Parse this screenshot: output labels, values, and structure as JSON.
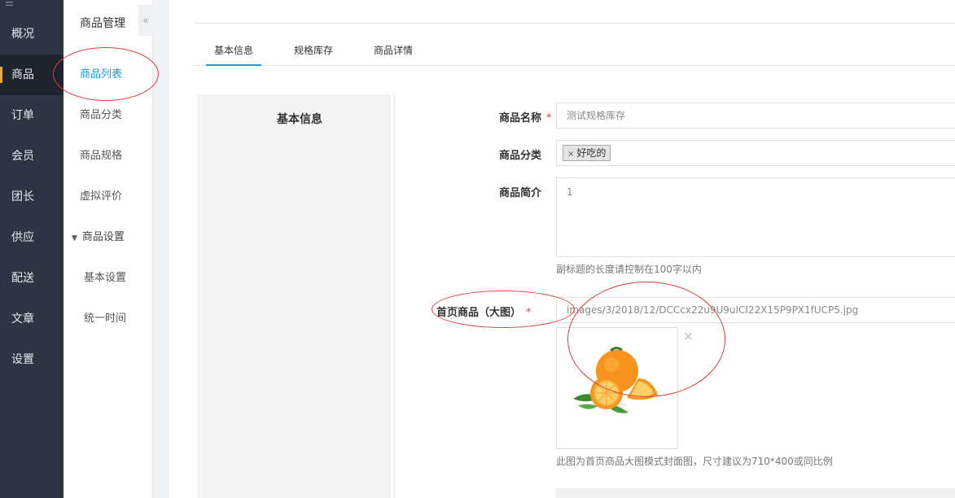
{
  "nav": {
    "items": [
      {
        "label": "概况"
      },
      {
        "label": "商品"
      },
      {
        "label": "订单"
      },
      {
        "label": "会员"
      },
      {
        "label": "团长"
      },
      {
        "label": "供应"
      },
      {
        "label": "配送"
      },
      {
        "label": "文章"
      },
      {
        "label": "设置"
      }
    ]
  },
  "subnav": {
    "title": "商品管理",
    "items": [
      {
        "label": "商品列表"
      },
      {
        "label": "商品分类"
      },
      {
        "label": "商品规格"
      },
      {
        "label": "虚拟评价"
      }
    ],
    "group": {
      "label": "商品设置",
      "items": [
        {
          "label": "基本设置"
        },
        {
          "label": "统一时间"
        }
      ]
    }
  },
  "tabs": [
    {
      "label": "基本信息"
    },
    {
      "label": "规格库存"
    },
    {
      "label": "商品详情"
    }
  ],
  "section": {
    "title": "基本信息"
  },
  "form": {
    "name": {
      "label": "商品名称",
      "required_mark": "*",
      "placeholder": "测试规格库存"
    },
    "category": {
      "label": "商品分类",
      "tag": "好吃的",
      "tag_remove": "×"
    },
    "intro": {
      "label": "商品简介",
      "value": "1",
      "help": "副标题的长度请控制在100字以内"
    },
    "cover": {
      "label": "首页商品（大图）",
      "required_mark": "*",
      "value": "images/3/2018/12/DCCcx22u9U9uICI22X15P9PX1fUCP5.jpg",
      "remove": "×",
      "help": "此图为首页商品大图模式封面图，尺寸建议为710*400或同比例"
    }
  },
  "colors": {
    "accent": "#1c9bd8",
    "nav_bg": "#2e3441",
    "annotation": "#e23c3c",
    "required": "#e0473d"
  }
}
